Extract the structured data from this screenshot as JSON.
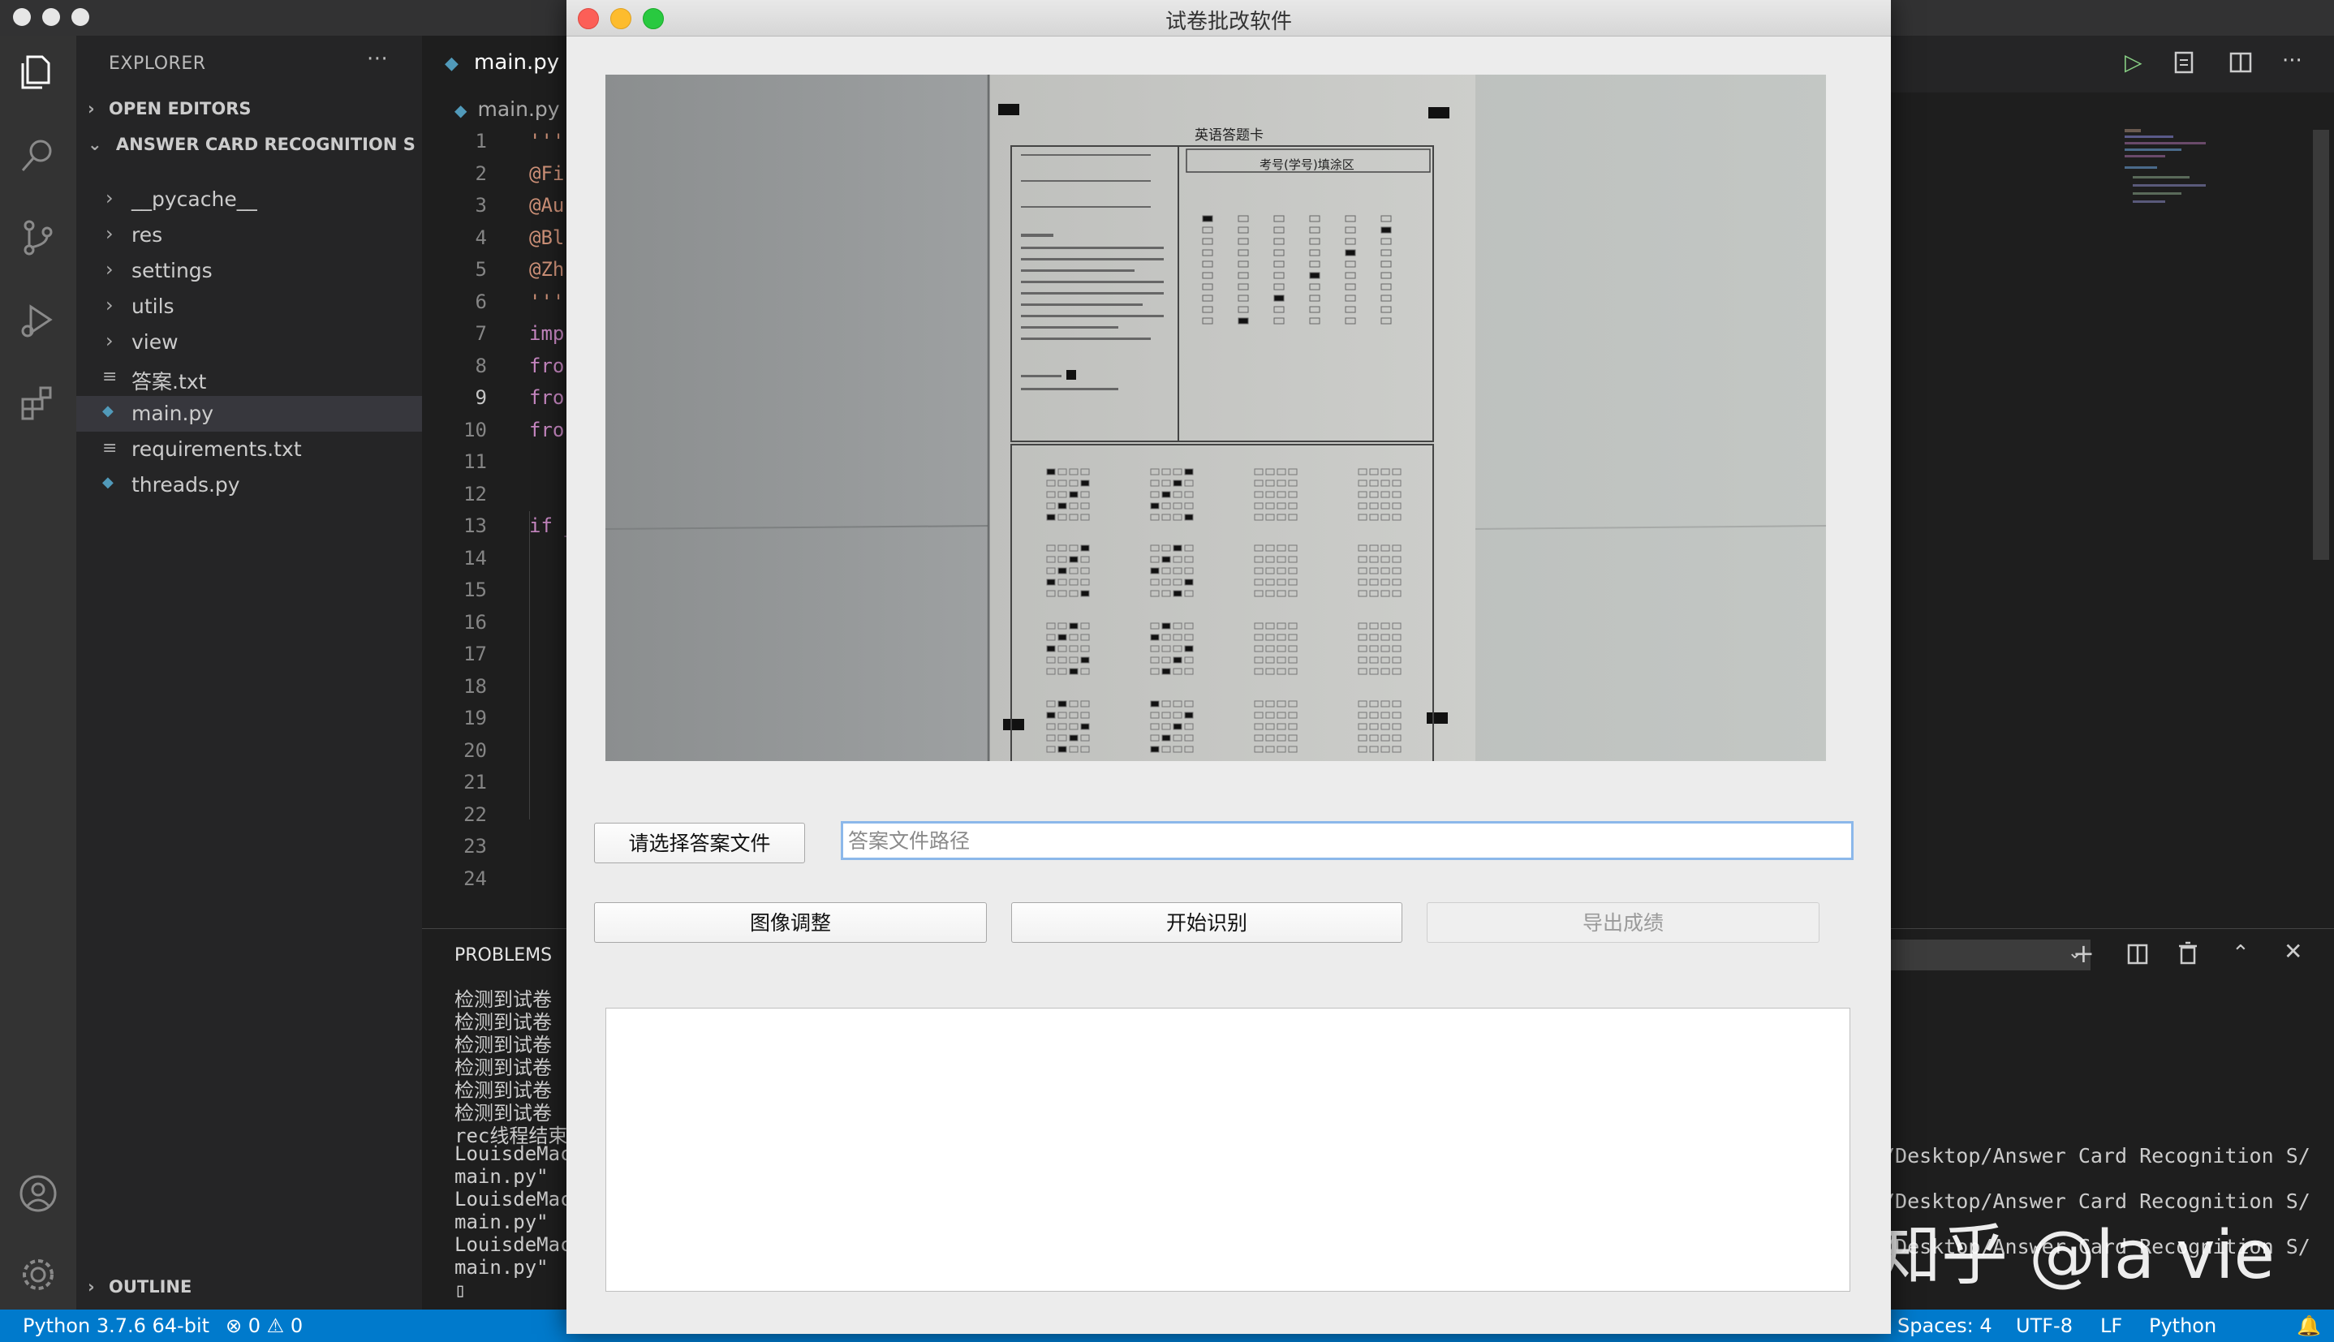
{
  "vscode": {
    "explorer_title": "EXPLORER",
    "explorer_more": "···",
    "open_editors": "OPEN EDITORS",
    "project": "ANSWER CARD RECOGNITION S",
    "outline": "OUTLINE",
    "tree": [
      {
        "label": "__pycache__",
        "type": "folder"
      },
      {
        "label": "res",
        "type": "folder"
      },
      {
        "label": "settings",
        "type": "folder"
      },
      {
        "label": "utils",
        "type": "folder"
      },
      {
        "label": "view",
        "type": "folder"
      },
      {
        "label": "答案.txt",
        "type": "text"
      },
      {
        "label": "main.py",
        "type": "python",
        "selected": true
      },
      {
        "label": "requirements.txt",
        "type": "text"
      },
      {
        "label": "threads.py",
        "type": "python"
      }
    ],
    "tab_label": "main.py",
    "breadcrumb": "main.py",
    "line_numbers": [
      "1",
      "2",
      "3",
      "4",
      "5",
      "6",
      "7",
      "8",
      "9",
      "10",
      "11",
      "12",
      "13",
      "14",
      "15",
      "16",
      "17",
      "18",
      "19",
      "20",
      "21",
      "22",
      "23",
      "24"
    ],
    "code_lines": [
      {
        "line": 1,
        "text": "'''",
        "color": "#ce9178"
      },
      {
        "line": 2,
        "text": "@Fi",
        "color": "#ce9178"
      },
      {
        "line": 3,
        "text": "@Au",
        "color": "#ce9178"
      },
      {
        "line": 4,
        "text": "@Bl",
        "color": "#ce9178"
      },
      {
        "line": 5,
        "text": "@Zh",
        "color": "#ce9178"
      },
      {
        "line": 6,
        "text": "'''",
        "color": "#ce9178"
      },
      {
        "line": 7,
        "text": "imp",
        "color": "#c586c0"
      },
      {
        "line": 8,
        "text": "fro",
        "color": "#c586c0"
      },
      {
        "line": 9,
        "text": "fro",
        "color": "#c586c0"
      },
      {
        "line": 10,
        "text": "fro",
        "color": "#c586c0"
      },
      {
        "line": 13,
        "text": "if _",
        "color": "#c586c0"
      }
    ],
    "panel_title": "PROBLEMS",
    "terminal_left": [
      "检测到试卷",
      "检测到试卷",
      "检测到试卷",
      "检测到试卷",
      "检测到试卷",
      "检测到试卷",
      "rec线程结束",
      "LouisdeMac",
      "main.py\"",
      "LouisdeMac",
      "main.py\"",
      "LouisdeMac",
      "main.py\"",
      "▯"
    ],
    "terminal_right": [
      "/Desktop/Answer Card Recognition S/",
      "/Desktop/Answer Card Recognition S/",
      "/Desktop/Answer Card Recognition S/"
    ],
    "status": {
      "interpreter": "Python 3.7.6 64-bit",
      "errors": "0",
      "warnings": "0",
      "spaces": "Spaces: 4",
      "encoding": "UTF-8",
      "eol": "LF",
      "language": "Python"
    },
    "watermark": "知乎 @la vie"
  },
  "app": {
    "title": "试卷批改软件",
    "choose_answer_button": "请选择答案文件",
    "answer_path_placeholder": "答案文件路径",
    "answer_path_value": "",
    "adjust_button": "图像调整",
    "start_button": "开始识别",
    "export_button": "导出成绩",
    "card_title": "英语答题卡",
    "card_id_title": "考号(学号)填涂区"
  }
}
